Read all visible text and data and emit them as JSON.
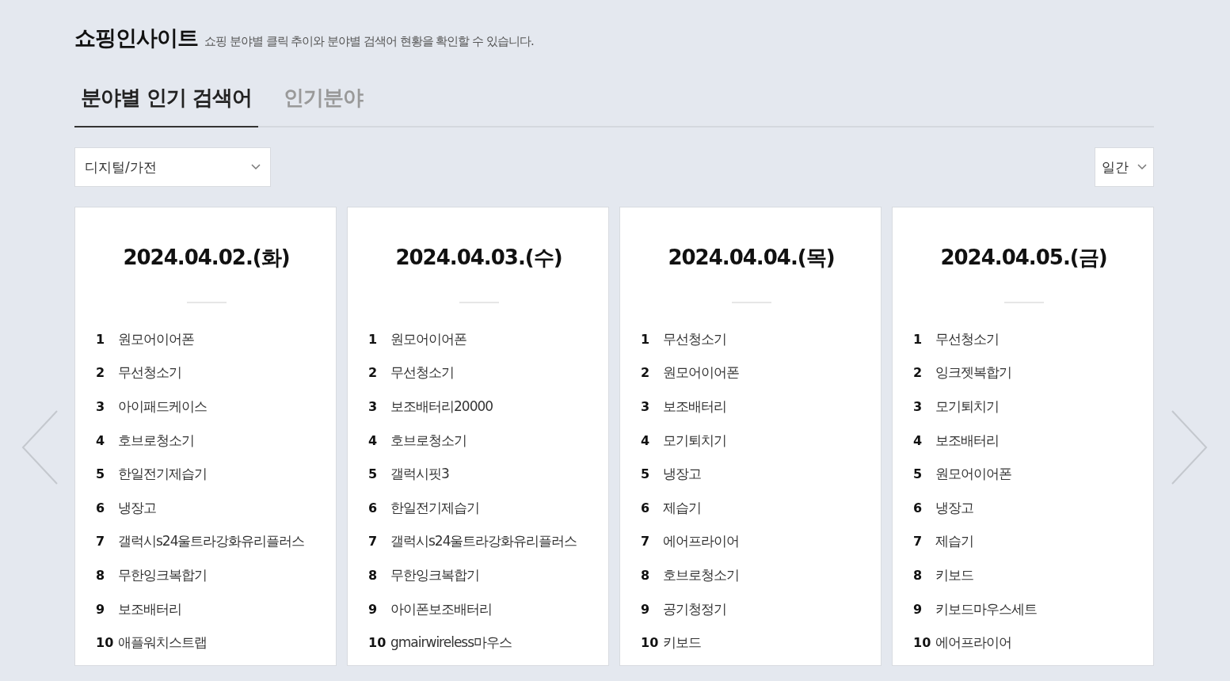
{
  "header": {
    "title": "쇼핑인사이트",
    "subtitle": "쇼핑 분야별 클릭 추이와 분야별 검색어 현황을 확인할 수 있습니다."
  },
  "tabs": [
    {
      "label": "분야별 인기 검색어",
      "selected": true
    },
    {
      "label": "인기분야",
      "selected": false
    }
  ],
  "category_select": {
    "value": "디지털/가전"
  },
  "period_select": {
    "value": "일간"
  },
  "cards": [
    {
      "date": "2024.04.02.(화)",
      "items": [
        {
          "rank": "1",
          "keyword": "원모어이어폰"
        },
        {
          "rank": "2",
          "keyword": "무선청소기"
        },
        {
          "rank": "3",
          "keyword": "아이패드케이스"
        },
        {
          "rank": "4",
          "keyword": "호브로청소기"
        },
        {
          "rank": "5",
          "keyword": "한일전기제습기"
        },
        {
          "rank": "6",
          "keyword": "냉장고"
        },
        {
          "rank": "7",
          "keyword": "갤럭시s24울트라강화유리플러스"
        },
        {
          "rank": "8",
          "keyword": "무한잉크복합기"
        },
        {
          "rank": "9",
          "keyword": "보조배터리"
        },
        {
          "rank": "10",
          "keyword": "애플워치스트랩"
        }
      ]
    },
    {
      "date": "2024.04.03.(수)",
      "items": [
        {
          "rank": "1",
          "keyword": "원모어이어폰"
        },
        {
          "rank": "2",
          "keyword": "무선청소기"
        },
        {
          "rank": "3",
          "keyword": "보조배터리20000"
        },
        {
          "rank": "4",
          "keyword": "호브로청소기"
        },
        {
          "rank": "5",
          "keyword": "갤럭시핏3"
        },
        {
          "rank": "6",
          "keyword": "한일전기제습기"
        },
        {
          "rank": "7",
          "keyword": "갤럭시s24울트라강화유리플러스"
        },
        {
          "rank": "8",
          "keyword": "무한잉크복합기"
        },
        {
          "rank": "9",
          "keyword": "아이폰보조배터리"
        },
        {
          "rank": "10",
          "keyword": "gmairwireless마우스"
        }
      ]
    },
    {
      "date": "2024.04.04.(목)",
      "items": [
        {
          "rank": "1",
          "keyword": "무선청소기"
        },
        {
          "rank": "2",
          "keyword": "원모어이어폰"
        },
        {
          "rank": "3",
          "keyword": "보조배터리"
        },
        {
          "rank": "4",
          "keyword": "모기퇴치기"
        },
        {
          "rank": "5",
          "keyword": "냉장고"
        },
        {
          "rank": "6",
          "keyword": "제습기"
        },
        {
          "rank": "7",
          "keyword": "에어프라이어"
        },
        {
          "rank": "8",
          "keyword": "호브로청소기"
        },
        {
          "rank": "9",
          "keyword": "공기청정기"
        },
        {
          "rank": "10",
          "keyword": "키보드"
        }
      ]
    },
    {
      "date": "2024.04.05.(금)",
      "items": [
        {
          "rank": "1",
          "keyword": "무선청소기"
        },
        {
          "rank": "2",
          "keyword": "잉크젯복합기"
        },
        {
          "rank": "3",
          "keyword": "모기퇴치기"
        },
        {
          "rank": "4",
          "keyword": "보조배터리"
        },
        {
          "rank": "5",
          "keyword": "원모어이어폰"
        },
        {
          "rank": "6",
          "keyword": "냉장고"
        },
        {
          "rank": "7",
          "keyword": "제습기"
        },
        {
          "rank": "8",
          "keyword": "키보드"
        },
        {
          "rank": "9",
          "keyword": "키보드마우스세트"
        },
        {
          "rank": "10",
          "keyword": "에어프라이어"
        }
      ]
    }
  ]
}
